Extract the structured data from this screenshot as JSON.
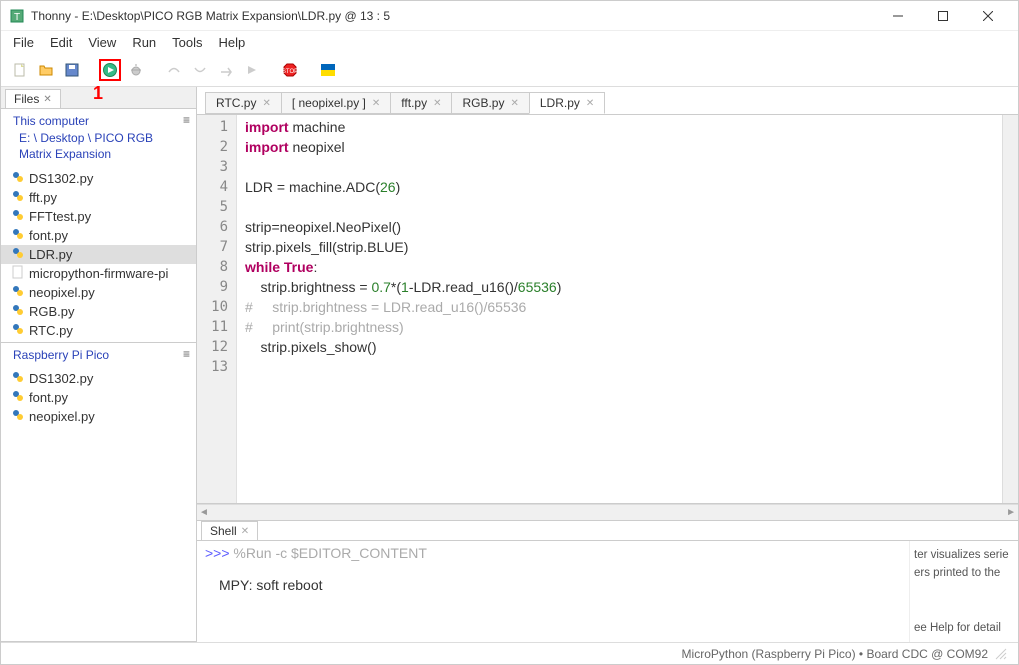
{
  "title": "Thonny  -  E:\\Desktop\\PICO RGB Matrix Expansion\\LDR.py  @  13 : 5",
  "menus": [
    "File",
    "Edit",
    "View",
    "Run",
    "Tools",
    "Help"
  ],
  "run_annotation": "1",
  "side_tab": "Files",
  "panel1": {
    "header": "This computer",
    "paths": [
      "E: \\ Desktop \\ PICO RGB",
      "Matrix Expansion"
    ],
    "files": [
      {
        "name": "DS1302.py",
        "type": "py"
      },
      {
        "name": "fft.py",
        "type": "py"
      },
      {
        "name": "FFTtest.py",
        "type": "py"
      },
      {
        "name": "font.py",
        "type": "py"
      },
      {
        "name": "LDR.py",
        "type": "py",
        "selected": true
      },
      {
        "name": "micropython-firmware-pi",
        "type": "doc"
      },
      {
        "name": "neopixel.py",
        "type": "py"
      },
      {
        "name": "RGB.py",
        "type": "py"
      },
      {
        "name": "RTC.py",
        "type": "py"
      }
    ]
  },
  "panel2": {
    "header": "Raspberry Pi Pico",
    "files": [
      {
        "name": "DS1302.py",
        "type": "py"
      },
      {
        "name": "font.py",
        "type": "py"
      },
      {
        "name": "neopixel.py",
        "type": "py"
      }
    ]
  },
  "tabs": [
    {
      "label": "RTC.py",
      "closable": true
    },
    {
      "label": "[ neopixel.py ]",
      "closable": true
    },
    {
      "label": "fft.py",
      "closable": true
    },
    {
      "label": "RGB.py",
      "closable": true
    },
    {
      "label": "LDR.py",
      "closable": true,
      "active": true
    }
  ],
  "code_lines": [
    {
      "n": 1,
      "html": "<span class='kw'>import</span> machine"
    },
    {
      "n": 2,
      "html": "<span class='kw'>import</span> neopixel"
    },
    {
      "n": 3,
      "html": ""
    },
    {
      "n": 4,
      "html": "LDR = machine.ADC(<span class='num'>26</span>)"
    },
    {
      "n": 5,
      "html": ""
    },
    {
      "n": 6,
      "html": "strip=neopixel.NeoPixel()"
    },
    {
      "n": 7,
      "html": "strip.pixels_fill(strip.BLUE)"
    },
    {
      "n": 8,
      "html": "<span class='kw'>while</span> <span class='kw2'>True</span>:"
    },
    {
      "n": 9,
      "html": "    strip.brightness = <span class='num'>0.7</span>*(<span class='num'>1</span>-LDR.read_u16()/<span class='num'>65536</span>)"
    },
    {
      "n": 10,
      "html": "<span class='cmt'>#     strip.brightness = LDR.read_u16()/65536</span>"
    },
    {
      "n": 11,
      "html": "<span class='cmt'>#     print(strip.brightness)</span>"
    },
    {
      "n": 12,
      "html": "    strip.pixels_show()"
    },
    {
      "n": 13,
      "html": ""
    }
  ],
  "shell_tab": "Shell",
  "shell_prompt": ">>> ",
  "shell_cmd": "%Run -c $EDITOR_CONTENT",
  "shell_output": "MPY: soft reboot",
  "help_lines": [
    "ter visualizes serie",
    "ers printed to the",
    "ee Help for detail"
  ],
  "status": "MicroPython (Raspberry Pi Pico)  •  Board CDC @ COM92"
}
